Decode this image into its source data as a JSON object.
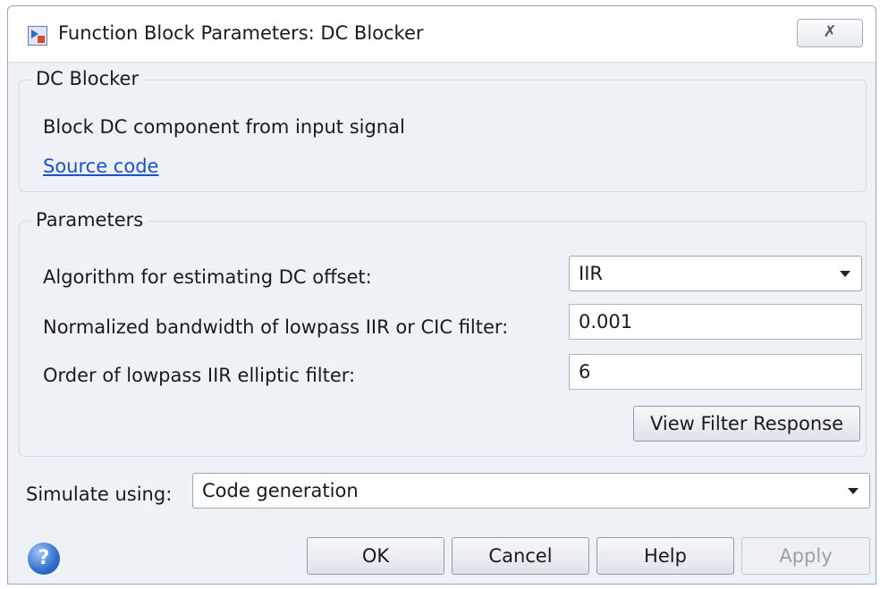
{
  "window": {
    "title": "Function Block Parameters: DC Blocker",
    "close_icon": "close-icon"
  },
  "description_group": {
    "label": "DC Blocker",
    "description": "Block DC component from input signal",
    "source_link": "Source code"
  },
  "parameters_group": {
    "label": "Parameters",
    "algorithm_label": "Algorithm for estimating DC offset:",
    "algorithm_value": "IIR",
    "bandwidth_label": "Normalized bandwidth of lowpass IIR or CIC filter:",
    "bandwidth_value": "0.001",
    "order_label": "Order of lowpass IIR elliptic filter:",
    "order_value": "6",
    "view_response_label": "View Filter Response"
  },
  "simulate": {
    "label": "Simulate using:",
    "value": "Code generation"
  },
  "buttons": {
    "ok": "OK",
    "cancel": "Cancel",
    "help": "Help",
    "apply": "Apply"
  },
  "icons": {
    "help": "help-icon",
    "app": "simulink-block-icon"
  }
}
